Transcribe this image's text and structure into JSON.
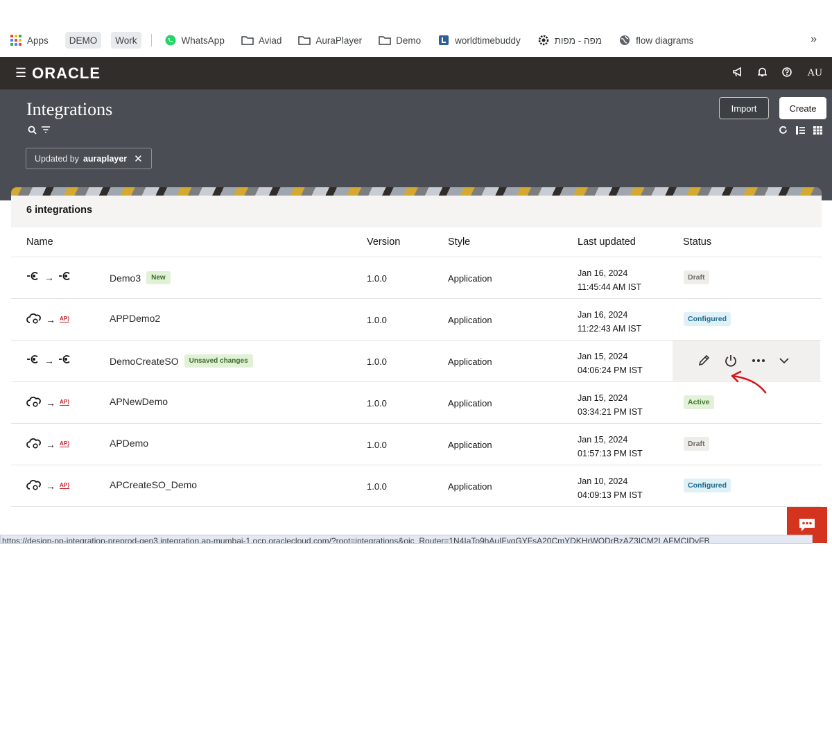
{
  "bookmarks": {
    "items": [
      {
        "label": "Apps",
        "icon": "apps-grid-icon",
        "kind": "apps"
      },
      {
        "label": "DEMO",
        "kind": "chip"
      },
      {
        "label": "Work",
        "kind": "chip"
      },
      {
        "label": "WhatsApp",
        "icon": "whatsapp-icon"
      },
      {
        "label": "Aviad",
        "icon": "folder-icon"
      },
      {
        "label": "AuraPlayer",
        "icon": "folder-icon"
      },
      {
        "label": "Demo",
        "icon": "folder-icon"
      },
      {
        "label": "worldtimebuddy",
        "icon": "worldtimebuddy-icon"
      },
      {
        "label": "מפה - מפות",
        "icon": "settings-gear-icon"
      },
      {
        "label": "flow diagrams",
        "icon": "globe-icon"
      }
    ],
    "more": "»"
  },
  "header": {
    "logo": "ORACLE",
    "user_initials": "AU"
  },
  "page": {
    "title": "Integrations",
    "import_label": "Import",
    "create_label": "Create",
    "filter": {
      "prefix": "Updated by",
      "value": "auraplayer"
    }
  },
  "table": {
    "count_label": "6 integrations",
    "columns": {
      "name": "Name",
      "version": "Version",
      "style": "Style",
      "last_updated": "Last updated",
      "status": "Status"
    },
    "rows": [
      {
        "name": "Demo3",
        "badge": "New",
        "version": "1.0.0",
        "style": "Application",
        "date": "Jan 16, 2024",
        "time": "11:45:44 AM IST",
        "status": "Draft",
        "status_kind": "draft",
        "source": "rest",
        "target": "rest"
      },
      {
        "name": "APPDemo2",
        "badge": "",
        "version": "1.0.0",
        "style": "Application",
        "date": "Jan 16, 2024",
        "time": "11:22:43 AM IST",
        "status": "Configured",
        "status_kind": "configured",
        "source": "cloud",
        "target": "ap"
      },
      {
        "name": "DemoCreateSO",
        "badge": "Unsaved changes",
        "version": "1.0.0",
        "style": "Application",
        "date": "Jan 15, 2024",
        "time": "04:06:24 PM IST",
        "status": "",
        "status_kind": "",
        "source": "rest",
        "target": "rest"
      },
      {
        "name": "APNewDemo",
        "badge": "",
        "version": "1.0.0",
        "style": "Application",
        "date": "Jan 15, 2024",
        "time": "03:34:21 PM IST",
        "status": "Active",
        "status_kind": "active",
        "source": "cloud",
        "target": "ap"
      },
      {
        "name": "APDemo",
        "badge": "",
        "version": "1.0.0",
        "style": "Application",
        "date": "Jan 15, 2024",
        "time": "01:57:13 PM IST",
        "status": "Draft",
        "status_kind": "draft",
        "source": "cloud",
        "target": "ap"
      },
      {
        "name": "APCreateSO_Demo",
        "badge": "",
        "version": "1.0.0",
        "style": "Application",
        "date": "Jan 10, 2024",
        "time": "04:09:13 PM IST",
        "status": "Configured",
        "status_kind": "configured",
        "source": "cloud",
        "target": "ap"
      }
    ]
  },
  "status_url": "https://design-pp-integration-preprod-gen3.integration.ap-mumbai-1.ocp.oraclecloud.com/?root=integrations&oic_Router=1N4IaTo9hAuIFvqGYFsA20CmYDKHrWODrBzAZ3ICM2LAFMCIDvFB",
  "colors": {
    "header_bg": "#312d2a",
    "pagehead_bg": "#4a4e54",
    "chat_btn": "#d4341e",
    "annotation": "#d6161a"
  }
}
